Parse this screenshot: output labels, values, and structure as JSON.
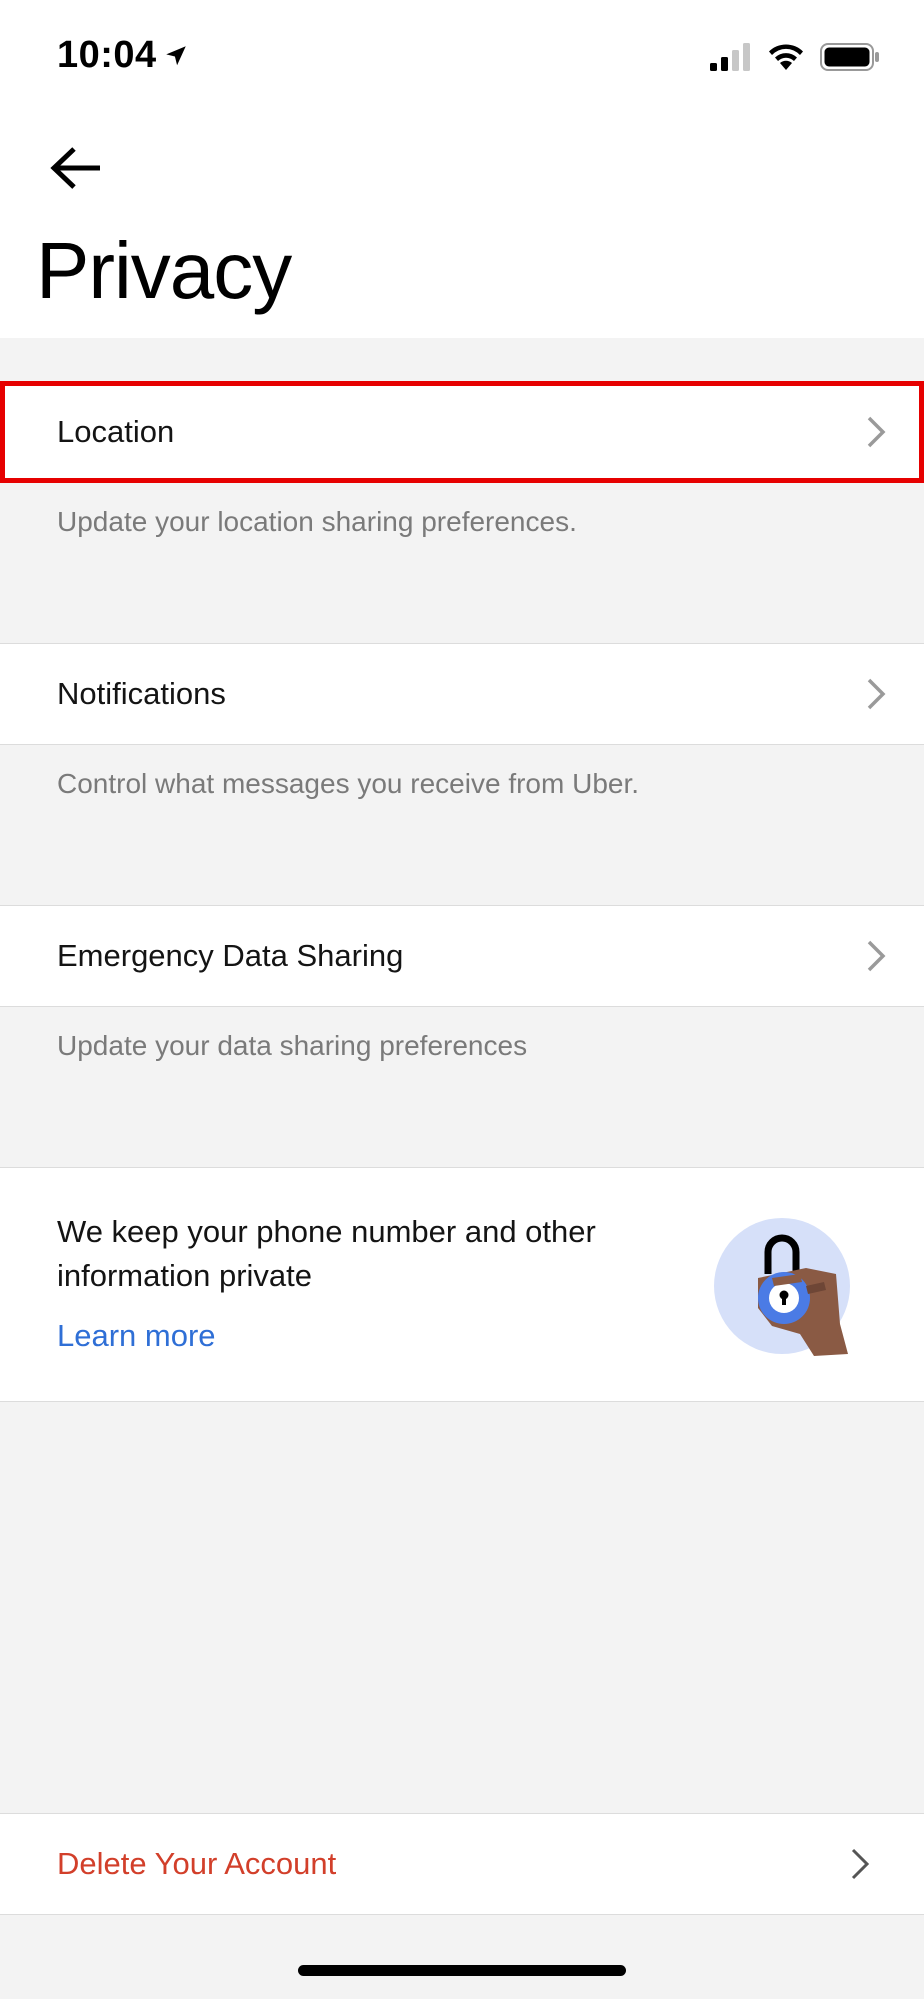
{
  "status_bar": {
    "time": "10:04",
    "location_icon": "location-arrow-icon",
    "signal_icon": "cellular-signal-icon",
    "wifi_icon": "wifi-icon",
    "battery_icon": "battery-icon"
  },
  "header": {
    "back_icon": "back-arrow-icon",
    "title": "Privacy"
  },
  "settings": [
    {
      "label": "Location",
      "description": "Update your location sharing preferences."
    },
    {
      "label": "Notifications",
      "description": "Control what messages you receive from Uber."
    },
    {
      "label": "Emergency Data Sharing",
      "description": "Update your data sharing preferences"
    }
  ],
  "info_card": {
    "text": "We keep your phone number and other information private",
    "link_label": "Learn more",
    "illustration_icon": "padlock-hand-icon"
  },
  "delete_account": {
    "label": "Delete Your Account"
  },
  "colors": {
    "highlight_border": "#e60000",
    "link": "#2f6fd6",
    "destructive": "#d23f2a",
    "description_text": "#7a7a7a",
    "page_background": "#f3f3f3"
  }
}
